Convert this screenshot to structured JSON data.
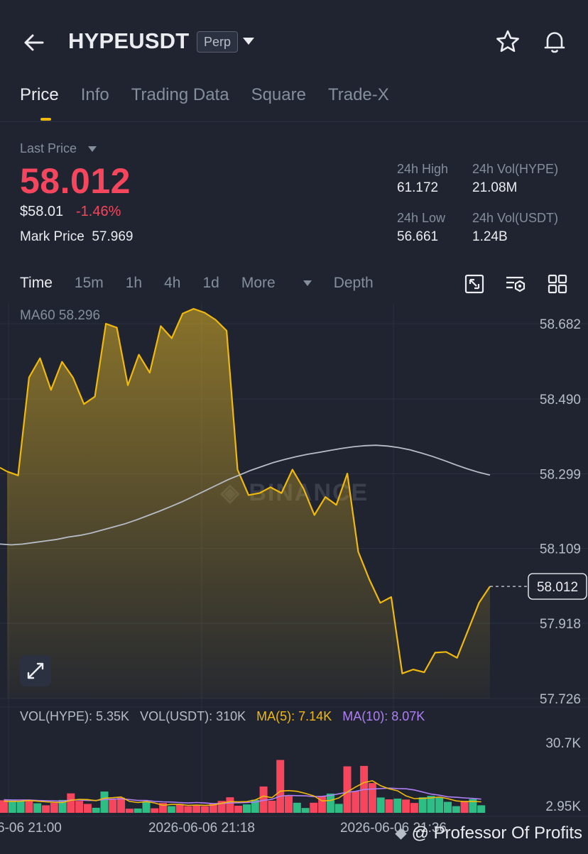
{
  "header": {
    "title": "HYPEUSDT",
    "badge": "Perp"
  },
  "tabs": [
    {
      "label": "Price",
      "active": true
    },
    {
      "label": "Info"
    },
    {
      "label": "Trading Data"
    },
    {
      "label": "Square"
    },
    {
      "label": "Trade-X"
    }
  ],
  "summary": {
    "last_price_label": "Last Price",
    "last_price": "58.012",
    "usd_price": "$58.01",
    "change_pct": "-1.46%",
    "mark_price_label": "Mark Price",
    "mark_price": "57.969",
    "high_label": "24h High",
    "high": "61.172",
    "low_label": "24h Low",
    "low": "56.661",
    "vol_hype_label": "24h Vol(HYPE)",
    "vol_hype": "21.08M",
    "vol_usdt_label": "24h Vol(USDT)",
    "vol_usdt": "1.24B"
  },
  "intervals": {
    "time": "Time",
    "m15": "15m",
    "h1": "1h",
    "h4": "4h",
    "d1": "1d",
    "more": "More",
    "depth": "Depth"
  },
  "colors": {
    "up": "#2ebd85",
    "down": "#f6465d",
    "accent": "#f0b90b",
    "ma10": "#b07ff5",
    "ma60": "#b7bdc6"
  },
  "chart_data": {
    "type": "line",
    "ma60_label": "MA60 58.296",
    "price_axis": {
      "ticks": [
        "58.682",
        "58.490",
        "58.299",
        "58.109",
        "57.918",
        "57.726"
      ],
      "ylim": [
        57.726,
        58.682
      ]
    },
    "current_price": 58.012,
    "current_price_label": "58.012",
    "price_series": [
      58.305,
      58.295,
      58.545,
      58.594,
      58.513,
      58.585,
      58.545,
      58.477,
      58.496,
      58.682,
      58.672,
      58.525,
      58.603,
      58.557,
      58.676,
      58.645,
      58.708,
      58.72,
      58.71,
      58.692,
      58.664,
      58.31,
      58.245,
      58.25,
      58.265,
      58.25,
      58.31,
      58.262,
      58.194,
      58.24,
      58.22,
      58.3,
      58.1,
      58.03,
      57.97,
      57.985,
      57.79,
      57.8,
      57.793,
      57.843,
      57.845,
      57.83,
      57.9,
      57.97,
      58.012
    ],
    "ma60_series": [
      58.12,
      58.118,
      58.12,
      58.124,
      58.128,
      58.132,
      58.138,
      58.142,
      58.148,
      58.156,
      58.164,
      58.172,
      58.182,
      58.193,
      58.204,
      58.216,
      58.228,
      58.242,
      58.256,
      58.27,
      58.284,
      58.296,
      58.308,
      58.318,
      58.328,
      58.336,
      58.343,
      58.349,
      58.354,
      58.359,
      58.364,
      58.368,
      58.371,
      58.372,
      58.37,
      58.366,
      58.36,
      58.352,
      58.343,
      58.333,
      58.322,
      58.312,
      58.303,
      58.296
    ],
    "volume": {
      "vol_hype_label": "VOL(HYPE): 5.35K",
      "vol_usdt_label": "VOL(USDT): 310K",
      "ma5_label": "MA(5): 7.14K",
      "ma10_label": "MA(10): 8.07K",
      "ticks": [
        "30.7K",
        "2.95K"
      ],
      "ylim": [
        2.95,
        30.7
      ],
      "bars": [
        {
          "v": 5.5,
          "up": false
        },
        {
          "v": 5.4,
          "up": true
        },
        {
          "v": 5.2,
          "up": true
        },
        {
          "v": 5.4,
          "up": false
        },
        {
          "v": 4.2,
          "up": true
        },
        {
          "v": 3.3,
          "up": false
        },
        {
          "v": 4.3,
          "up": false
        },
        {
          "v": 5.6,
          "up": true
        },
        {
          "v": 8.5,
          "up": false
        },
        {
          "v": 5.2,
          "up": false
        },
        {
          "v": 3.9,
          "up": false
        },
        {
          "v": 2.2,
          "up": true
        },
        {
          "v": 9.3,
          "up": true
        },
        {
          "v": 5.8,
          "up": false
        },
        {
          "v": 6.6,
          "up": false
        },
        {
          "v": 1.8,
          "up": false
        },
        {
          "v": 1.9,
          "up": true
        },
        {
          "v": 5.0,
          "up": true
        },
        {
          "v": 2.0,
          "up": false
        },
        {
          "v": 4.3,
          "up": false
        },
        {
          "v": 2.9,
          "up": true
        },
        {
          "v": 3.8,
          "up": false
        },
        {
          "v": 2.9,
          "up": false
        },
        {
          "v": 3.2,
          "up": false
        },
        {
          "v": 2.9,
          "up": false
        },
        {
          "v": 3.9,
          "up": false
        },
        {
          "v": 5.2,
          "up": false
        },
        {
          "v": 6.8,
          "up": false
        },
        {
          "v": 3.1,
          "up": false
        },
        {
          "v": 3.7,
          "up": true
        },
        {
          "v": 5.7,
          "up": true
        },
        {
          "v": 11.5,
          "up": false
        },
        {
          "v": 5.3,
          "up": false
        },
        {
          "v": 23.1,
          "up": false
        },
        {
          "v": 7.3,
          "up": false
        },
        {
          "v": 4.4,
          "up": true
        },
        {
          "v": 2.1,
          "up": true
        },
        {
          "v": 4.4,
          "up": false
        },
        {
          "v": 7.3,
          "up": false
        },
        {
          "v": 8.4,
          "up": true
        },
        {
          "v": 3.9,
          "up": true
        },
        {
          "v": 20.3,
          "up": false
        },
        {
          "v": 9.4,
          "up": false
        },
        {
          "v": 20.5,
          "up": false
        },
        {
          "v": 13.0,
          "up": false
        },
        {
          "v": 6.7,
          "up": true
        },
        {
          "v": 5.9,
          "up": false
        },
        {
          "v": 6.2,
          "up": true
        },
        {
          "v": 5.8,
          "up": false
        },
        {
          "v": 4.3,
          "up": false
        },
        {
          "v": 6.8,
          "up": true
        },
        {
          "v": 7.4,
          "up": true
        },
        {
          "v": 6.6,
          "up": true
        },
        {
          "v": 4.8,
          "up": true
        },
        {
          "v": 2.9,
          "up": true
        },
        {
          "v": 5.2,
          "up": false
        },
        {
          "v": 6.0,
          "up": true
        },
        {
          "v": 3.3,
          "up": true
        }
      ],
      "ma5_series": [
        5.1,
        5.0,
        5.1,
        5.4,
        5.1,
        4.8,
        4.6,
        4.5,
        5.5,
        5.9,
        5.8,
        5.3,
        6.4,
        6.6,
        6.9,
        5.0,
        4.5,
        4.9,
        4.3,
        3.3,
        3.7,
        3.7,
        3.3,
        3.4,
        3.3,
        3.4,
        4.2,
        4.9,
        4.8,
        4.9,
        5.6,
        7.3,
        6.6,
        9.5,
        9.7,
        9.4,
        8.5,
        7.4,
        5.2,
        5.4,
        6.5,
        9.1,
        11.3,
        13.2,
        14.0,
        11.8,
        10.5,
        9.6,
        7.4,
        6.2,
        6.3,
        6.5,
        6.9,
        6.2,
        5.2,
        4.9,
        5.0,
        4.8
      ],
      "ma10_series": [
        5.7,
        5.6,
        5.6,
        5.6,
        5.4,
        5.3,
        5.2,
        5.1,
        5.6,
        5.6,
        5.4,
        5.4,
        5.8,
        6.0,
        6.1,
        5.8,
        5.4,
        5.4,
        5.0,
        4.8,
        4.7,
        4.5,
        4.3,
        4.5,
        4.3,
        4.0,
        4.1,
        4.3,
        4.4,
        4.5,
        4.7,
        5.5,
        5.9,
        7.3,
        7.6,
        7.5,
        7.4,
        7.1,
        7.2,
        7.6,
        8.3,
        9.0,
        9.4,
        10.2,
        10.4,
        10.6,
        10.8,
        10.6,
        10.5,
        10.0,
        9.1,
        8.2,
        7.7,
        7.0,
        6.8,
        6.5,
        6.3,
        6.0
      ]
    },
    "time_axis": [
      "6-06 21:00",
      "2026-06-06 21:18",
      "2026-06-06 21:36"
    ]
  },
  "watermark": {
    "chart": "BINANCE",
    "overlay": "@ Professor Of Profits"
  }
}
